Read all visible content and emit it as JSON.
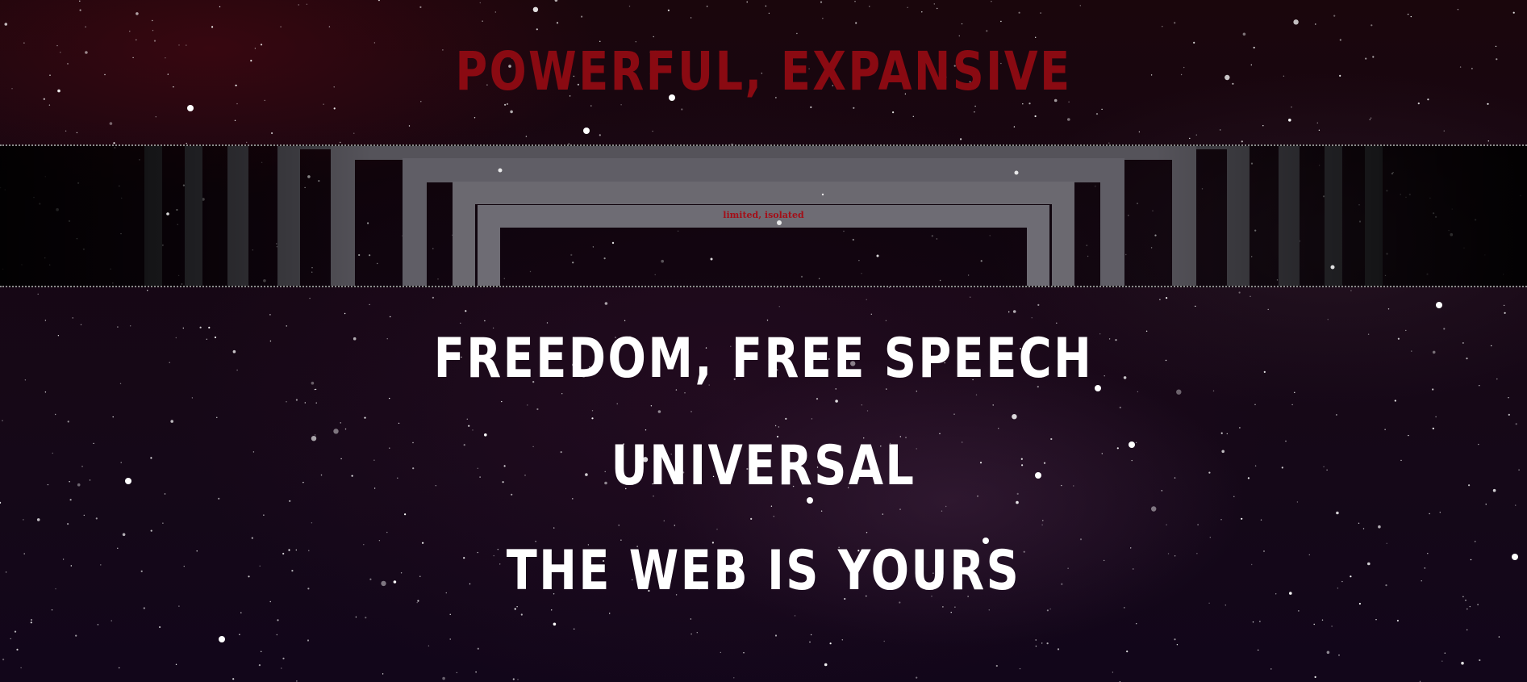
{
  "hero": {
    "tagline_top": "POWERFUL, EXPANSIVE",
    "band_caption": "limited, isolated",
    "slogans": [
      "FREEDOM, FREE SPEECH",
      "UNIVERSAL",
      "THE WEB IS YOURS"
    ]
  },
  "colors": {
    "tagline_top": "#8a0a12",
    "band_caption": "#a30f18",
    "slogans": "#ffffff",
    "background": "#150818"
  }
}
